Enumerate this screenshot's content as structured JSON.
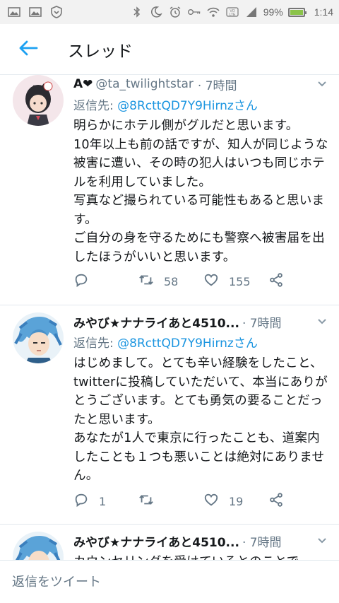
{
  "status_bar": {
    "battery_text": "99%",
    "battery_level": 0.99,
    "time": "1:14",
    "left_icons": [
      "gallery-icon",
      "gallery-icon",
      "vpn-shield-icon"
    ],
    "right_icons": [
      "bluetooth-icon",
      "moon-icon",
      "alarm-icon",
      "key-icon",
      "wifi-icon",
      "volte-icon",
      "signal-icon"
    ]
  },
  "header": {
    "title": "スレッド"
  },
  "tweets": [
    {
      "name": "A❤",
      "handle": "@ta_twilightstar",
      "time": "· 7時間",
      "reply_label": "返信先: ",
      "reply_mention": "@8RcttQD7Y9Hirnzさん",
      "text": "明らかにホテル側がグルだと思います。\n10年以上も前の話ですが、知人が同じような被害に遭い、その時の犯人はいつも同じホテルを利用していました。\n写真など撮られている可能性もあると思います。\nご自分の身を守るためにも警察へ被害届を出したほうがいいと思います。",
      "replies": "",
      "retweets": "58",
      "likes": "155"
    },
    {
      "name": "みやび★ナナライあと4510...",
      "handle": "",
      "time": "· 7時間",
      "reply_label": "返信先: ",
      "reply_mention": "@8RcttQD7Y9Hirnzさん",
      "text": "はじめまして。とても辛い経験をしたこと、twitterに投稿していただいて、本当にありがとうございます。とても勇気の要ることだったと思います。\nあなたが1人で東京に行ったことも、道案内したことも１つも悪いことは絶対にありません。",
      "replies": "1",
      "retweets": "",
      "likes": "19"
    },
    {
      "name": "みやび★ナナライあと4510...",
      "handle": "",
      "time": "· 7時間",
      "text": "カウンセリングを受けているとのことで"
    }
  ],
  "composer": {
    "placeholder": "返信をツイート"
  },
  "colors": {
    "accent": "#1da1f2",
    "mention": "#1b95e0",
    "secondary_text": "#657786",
    "battery": "#8bc34a"
  }
}
